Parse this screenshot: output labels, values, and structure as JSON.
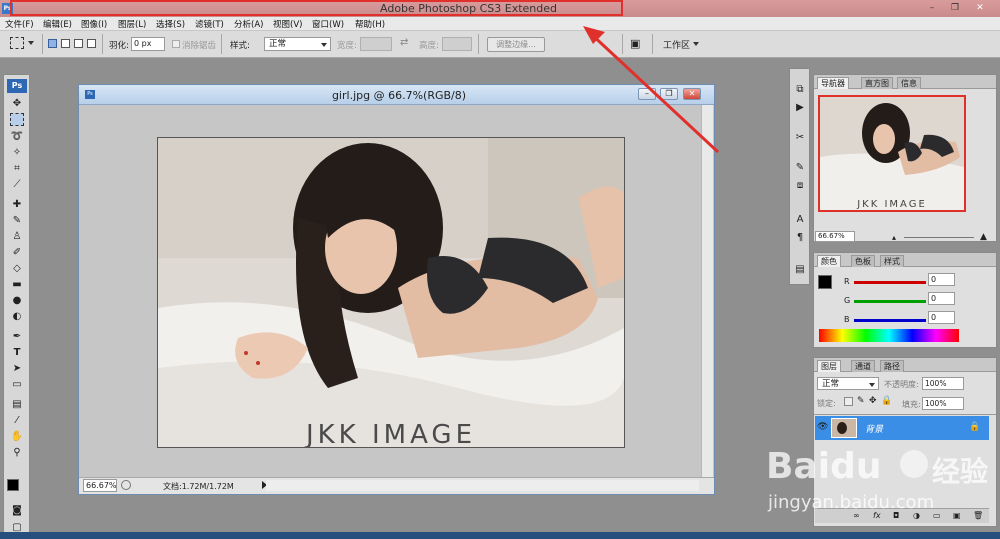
{
  "app": {
    "title": "Adobe Photoshop CS3 Extended",
    "logo_text": "Ps"
  },
  "window_buttons": {
    "minimize": "–",
    "maximize": "❐",
    "close": "✕"
  },
  "menu": [
    "文件(F)",
    "编辑(E)",
    "图像(I)",
    "图层(L)",
    "选择(S)",
    "滤镜(T)",
    "分析(A)",
    "视图(V)",
    "窗口(W)",
    "帮助(H)"
  ],
  "options": {
    "feather_label": "羽化:",
    "feather_value": "0 px",
    "antialias_label": "消除锯齿",
    "style_label": "样式:",
    "style_value": "正常",
    "width_label": "宽度:",
    "height_label": "高度:",
    "refine_button": "调整边缘...",
    "workspace_label": "工作区"
  },
  "document": {
    "title": "girl.jpg @ 66.7%(RGB/8)",
    "zoom": "66.67%",
    "doc_info": "文档:1.72M/1.72M",
    "image_caption": "JKK IMAGE"
  },
  "navigator": {
    "tabs": [
      "导航器",
      "直方图",
      "信息"
    ],
    "zoom": "66.67%",
    "image_caption": "JKK IMAGE"
  },
  "color_panel": {
    "tabs": [
      "颜色",
      "色板",
      "样式"
    ],
    "channels": [
      {
        "label": "R",
        "value": "0",
        "color": "#cc0000"
      },
      {
        "label": "G",
        "value": "0",
        "color": "#00a000"
      },
      {
        "label": "B",
        "value": "0",
        "color": "#0000cc"
      }
    ]
  },
  "layers_panel": {
    "tabs": [
      "图层",
      "通道",
      "路径"
    ],
    "blend_mode": "正常",
    "opacity_label": "不透明度:",
    "opacity_value": "100%",
    "lock_label": "锁定:",
    "fill_label": "填充:",
    "fill_value": "100%",
    "layer_name": "背景",
    "bottom_icons": [
      "∞",
      "fx",
      "◘",
      "◑",
      "▭",
      "▣",
      "🗑"
    ]
  },
  "watermark": {
    "brand": "Baidu",
    "brand_cn": "经验",
    "url": "jingyan.baidu.com"
  },
  "colors": {
    "highlight": "#e0302c",
    "selection": "#3b8ee6",
    "titlebar": "#cf9393"
  }
}
